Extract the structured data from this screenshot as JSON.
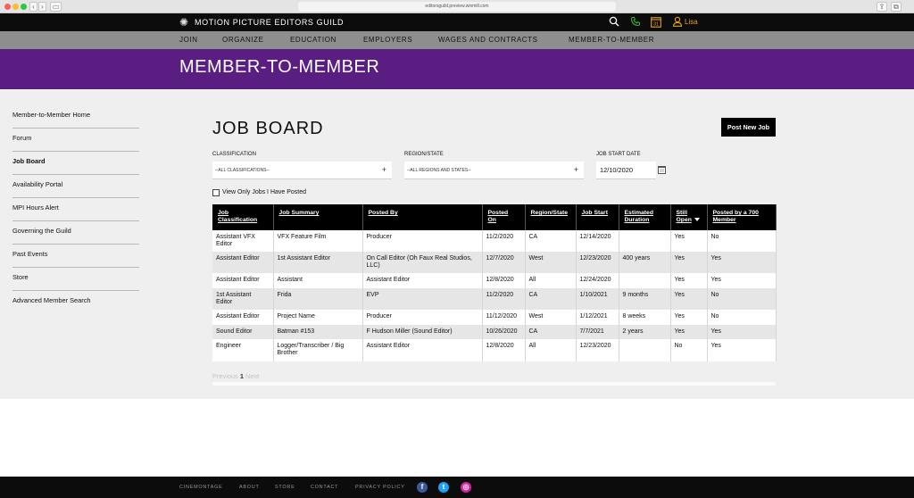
{
  "browser": {
    "url": "editorsguild.preview.winmill.com",
    "back_glyph": "‹",
    "forward_glyph": "›",
    "sidebar_glyph": "▭",
    "share_glyph": "⇪",
    "tabs_glyph": "⧉"
  },
  "header": {
    "site_name": "MOTION PICTURE EDITORS GUILD",
    "logo_glyph": "✺",
    "calendar_number": "31",
    "user_name": "Lisa",
    "icons": [
      "search-icon",
      "phone-icon",
      "calendar-icon",
      "user-icon"
    ],
    "accent_color": "#e8a020",
    "phone_color": "#3fae3f"
  },
  "nav": {
    "items": [
      "JOIN",
      "ORGANIZE",
      "EDUCATION",
      "EMPLOYERS",
      "WAGES AND CONTRACTS",
      "MEMBER-TO-MEMBER"
    ]
  },
  "banner": {
    "title": "MEMBER-TO-MEMBER",
    "color": "#5a1e83"
  },
  "sidebar": {
    "items": [
      {
        "label": "Member-to-Member Home",
        "active": false
      },
      {
        "label": "Forum",
        "active": false
      },
      {
        "label": "Job Board",
        "active": true
      },
      {
        "label": "Availability Portal",
        "active": false
      },
      {
        "label": "MPI Hours Alert",
        "active": false
      },
      {
        "label": "Governing the Guild",
        "active": false
      },
      {
        "label": "Past Events",
        "active": false
      },
      {
        "label": "Store",
        "active": false
      },
      {
        "label": "Advanced Member Search",
        "active": false
      }
    ]
  },
  "main": {
    "title": "JOB BOARD",
    "post_button": "Post New Job",
    "filters": {
      "classification_label": "CLASSIFICATION",
      "classification_value": "--ALL CLASSIFICATIONS--",
      "region_label": "REGION/STATE",
      "region_value": "--ALL REGIONS AND STATES--",
      "date_label": "JOB START DATE",
      "date_value": "12/10/2020",
      "plus_glyph": "+"
    },
    "only_mine_label": "View Only Jobs I Have Posted",
    "only_mine_checked": false,
    "table": {
      "headers": [
        {
          "line1": "Job",
          "line2": "Classification"
        },
        {
          "line1": "Job Summary",
          "line2": ""
        },
        {
          "line1": "Posted By",
          "line2": ""
        },
        {
          "line1": "Posted",
          "line2": "On"
        },
        {
          "line1": "Region/State",
          "line2": ""
        },
        {
          "line1": "Job Start",
          "line2": ""
        },
        {
          "line1": "Estimated",
          "line2": "Duration"
        },
        {
          "line1": "Still",
          "line2": "Open"
        },
        {
          "line1": "Posted by a 700",
          "line2": "Member"
        }
      ],
      "sorted_column": 7,
      "rows": [
        [
          "Assistant VFX Editor",
          "VFX Feature Film",
          "Producer",
          "11/2/2020",
          "CA",
          "12/14/2020",
          "",
          "Yes",
          "No"
        ],
        [
          "Assistant Editor",
          "1st Assistant Editor",
          "On Call Editor (Oh Faux Real Studios, LLC)",
          "12/7/2020",
          "West",
          "12/23/2020",
          "400 years",
          "Yes",
          "Yes"
        ],
        [
          "Assistant Editor",
          "Assistant",
          "Assistant Editor",
          "12/8/2020",
          "All",
          "12/24/2020",
          "",
          "Yes",
          "Yes"
        ],
        [
          "1st Assistant Editor",
          "Frida",
          "EVP",
          "11/2/2020",
          "CA",
          "1/10/2021",
          "9 months",
          "Yes",
          "No"
        ],
        [
          "Assistant Editor",
          "Project Name",
          "Producer",
          "11/12/2020",
          "West",
          "1/12/2021",
          "8 weeks",
          "Yes",
          "No"
        ],
        [
          "Sound Editor",
          "Batman #153",
          "F Hudson Miller (Sound Editor)",
          "10/26/2020",
          "CA",
          "7/7/2021",
          "2 years",
          "Yes",
          "Yes"
        ],
        [
          "Engineer",
          "Logger/Transcriber / Big Brother",
          "Assistant Editor",
          "12/8/2020",
          "All",
          "12/23/2020",
          "",
          "No",
          "Yes"
        ]
      ]
    },
    "pager": {
      "previous": "Previous",
      "current": "1",
      "next": "Next"
    }
  },
  "footer": {
    "links": [
      "CINEMONTAGE",
      "ABOUT",
      "STORE",
      "CONTACT",
      "PRIVACY POLICY"
    ],
    "social": [
      {
        "name": "facebook-icon",
        "glyph": "f",
        "color": "#3b5998"
      },
      {
        "name": "twitter-icon",
        "glyph": "t",
        "color": "#1da1f2"
      },
      {
        "name": "instagram-icon",
        "glyph": "◎",
        "color": "#d6249f"
      }
    ]
  }
}
